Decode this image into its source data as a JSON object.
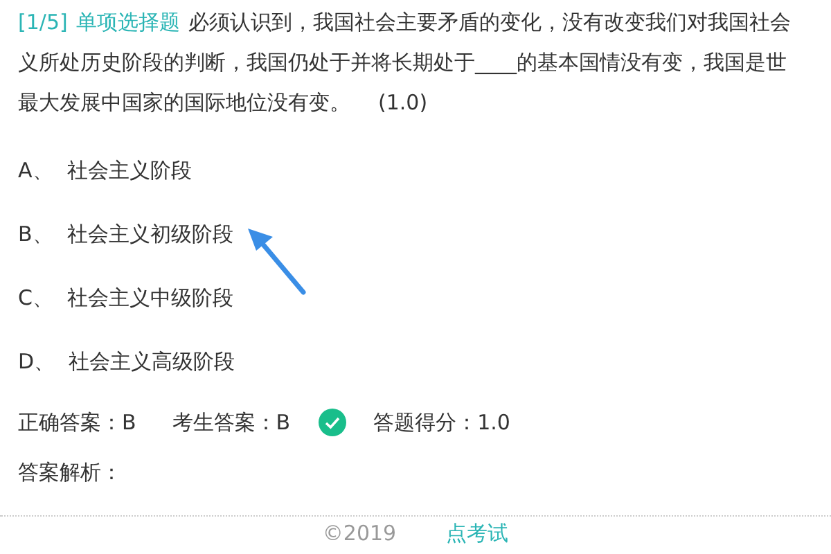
{
  "question": {
    "number": "[1/5]",
    "type": "单项选择题",
    "lines": [
      "必须认识到，我国社会主要矛盾的变化，没有改变我们对我国社会",
      "义所处历史阶段的判断，我国仍处于并将长期处于____的基本国情没有变，我国是世",
      "最大发展中国家的国际地位没有变。"
    ],
    "score": "(1.0)"
  },
  "options": [
    {
      "letter": "A、",
      "text": "社会主义阶段"
    },
    {
      "letter": "B、",
      "text": "社会主义初级阶段"
    },
    {
      "letter": "C、",
      "text": "社会主义中级阶段"
    },
    {
      "letter": "D、",
      "text": "社会主义高级阶段"
    }
  ],
  "result": {
    "correct_answer": "正确答案：B",
    "student_answer": "考生答案：B",
    "correct": true,
    "points": "答题得分：1.0"
  },
  "analysis_label": "答案解析：",
  "footer": {
    "copyright": "©2019",
    "brand": "点考试"
  }
}
